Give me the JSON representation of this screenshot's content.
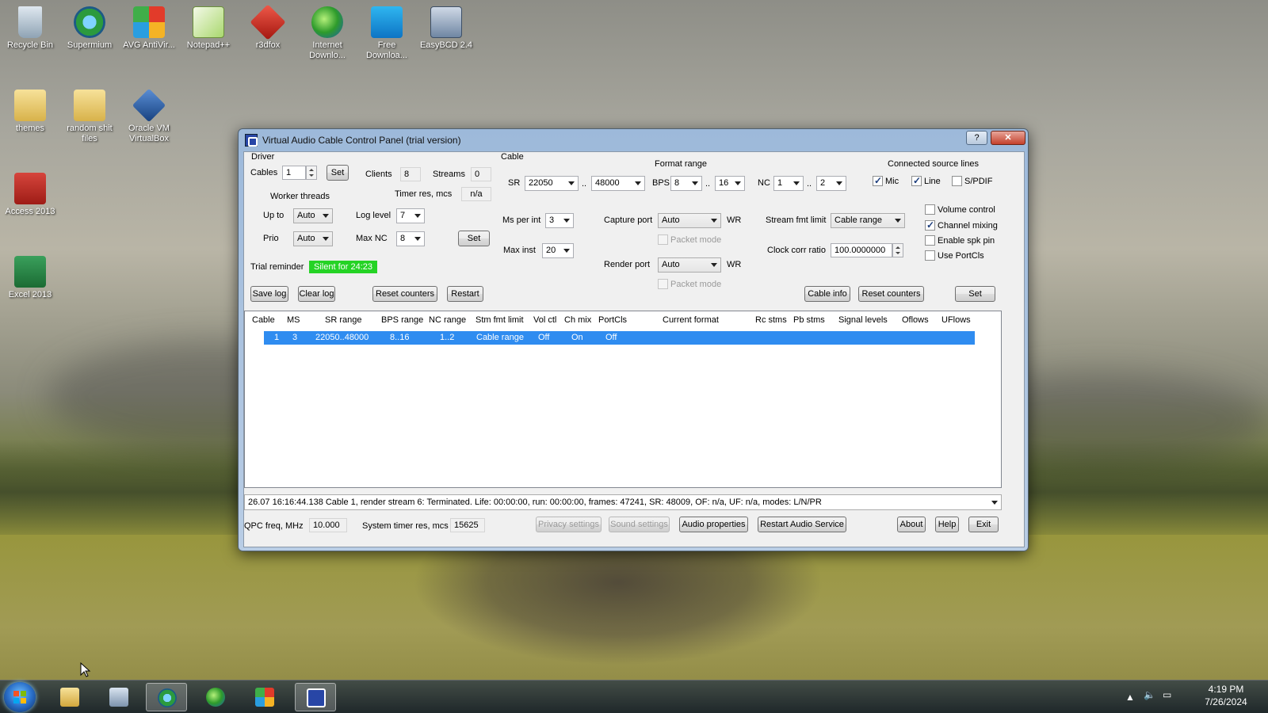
{
  "desktop": {
    "icons": [
      {
        "label": "Recycle Bin"
      },
      {
        "label": "Supermium"
      },
      {
        "label": "AVG AntiVir..."
      },
      {
        "label": "Notepad++"
      },
      {
        "label": "r3dfox"
      },
      {
        "label": "Internet Downlo..."
      },
      {
        "label": "Free Downloa..."
      },
      {
        "label": "EasyBCD 2.4"
      },
      {
        "label": "themes"
      },
      {
        "label": "random shit files"
      },
      {
        "label": "Oracle VM VirtualBox"
      },
      {
        "label": "Access 2013"
      },
      {
        "label": "Excel 2013"
      }
    ]
  },
  "window": {
    "title": "Virtual Audio Cable Control Panel (trial version)",
    "help_btn": "?",
    "close_btn": "✕",
    "driver": {
      "group_label": "Driver",
      "cables_label": "Cables",
      "cables_value": "1",
      "set_label": "Set",
      "clients_label": "Clients",
      "clients_value": "8",
      "streams_label": "Streams",
      "streams_value": "0",
      "worker_threads_label": "Worker threads",
      "timer_res_label": "Timer res, mcs",
      "timer_res_value": "n/a",
      "upto_label": "Up to",
      "upto_value": "Auto",
      "log_level_label": "Log level",
      "log_level_value": "7",
      "prio_label": "Prio",
      "prio_value": "Auto",
      "max_nc_label": "Max NC",
      "max_nc_value": "8",
      "set2_label": "Set",
      "trial_label": "Trial reminder",
      "trial_value": "Silent for 24:23",
      "save_log": "Save log",
      "clear_log": "Clear log",
      "reset_counters": "Reset counters",
      "restart": "Restart"
    },
    "cable": {
      "group_label": "Cable",
      "format_range_label": "Format range",
      "sr_label": "SR",
      "sr_min": "22050",
      "sr_max": "48000",
      "dots1": "..",
      "bps_label": "BPS",
      "bps_min": "8",
      "bps_max": "16",
      "dots2": "..",
      "nc_label": "NC",
      "nc_min": "1",
      "nc_max": "2",
      "dots3": "..",
      "connected_label": "Connected source lines",
      "mic_label": "Mic",
      "mic_checked": true,
      "line_label": "Line",
      "line_checked": true,
      "spdif_label": "S/PDIF",
      "spdif_checked": false,
      "ms_per_int_label": "Ms per int",
      "ms_per_int_value": "3",
      "max_inst_label": "Max inst",
      "max_inst_value": "20",
      "capture_port_label": "Capture port",
      "capture_port_value": "Auto",
      "capture_wr": "WR",
      "capture_packet": "Packet mode",
      "render_port_label": "Render port",
      "render_port_value": "Auto",
      "render_wr": "WR",
      "render_packet": "Packet mode",
      "stream_fmt_label": "Stream fmt limit",
      "stream_fmt_value": "Cable range",
      "clock_corr_label": "Clock corr ratio",
      "clock_corr_value": "100.0000000",
      "volume_control": "Volume control",
      "volume_checked": false,
      "channel_mixing": "Channel mixing",
      "channel_checked": true,
      "enable_spk": "Enable spk pin",
      "spk_checked": false,
      "use_portcls": "Use PortCls",
      "portcls_checked": false,
      "cable_info": "Cable info",
      "reset_counters": "Reset counters",
      "set_label": "Set"
    },
    "table": {
      "headers": [
        "Cable",
        "MS",
        "SR range",
        "BPS range",
        "NC range",
        "Stm fmt limit",
        "Vol ctl",
        "Ch mix",
        "PortCls",
        "Current format",
        "Rc stms",
        "Pb stms",
        "Signal levels",
        "Oflows",
        "UFlows"
      ],
      "rows": [
        {
          "cable": "1",
          "ms": "3",
          "sr_range": "22050..48000",
          "bps_range": "8..16",
          "nc_range": "1..2",
          "stm_fmt": "Cable range",
          "vol_ctl": "Off",
          "ch_mix": "On",
          "portcls": "Off"
        }
      ]
    },
    "status": "26.07   16:16:44.138   Cable 1, render stream 6: Terminated. Life: 00:00:00, run: 00:00:00, frames: 47241, SR: 48009, OF: n/a, UF: n/a, modes: L/N/PR",
    "bottom": {
      "qpc_label": "QPC freq, MHz",
      "qpc_value": "10.000",
      "sys_timer_label": "System timer res, mcs",
      "sys_timer_value": "15625",
      "privacy": "Privacy settings",
      "sound": "Sound settings",
      "audio_props": "Audio properties",
      "restart_service": "Restart Audio Service",
      "about": "About",
      "help": "Help",
      "exit": "Exit"
    }
  },
  "taskbar": {
    "time": "4:19 PM",
    "date": "7/26/2024"
  }
}
